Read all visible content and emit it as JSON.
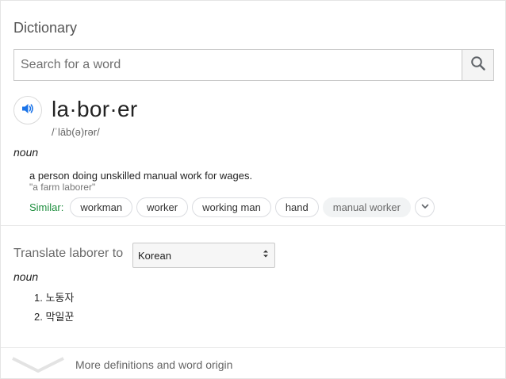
{
  "dictionary": {
    "title": "Dictionary",
    "search": {
      "placeholder": "Search for a word",
      "value": ""
    },
    "icons": {
      "search": "search-icon",
      "speaker": "speaker-icon",
      "expand": "chevron-down-icon"
    },
    "entry": {
      "headword": "la·bor·er",
      "phonetic": "/ˈlāb(ə)rər/",
      "part_of_speech": "noun",
      "definition": "a person doing unskilled manual work for wages.",
      "example": "\"a farm laborer\"",
      "similar_label": "Similar:",
      "similar": [
        "workman",
        "worker",
        "working man",
        "hand",
        "manual worker"
      ]
    },
    "translate": {
      "label": "Translate laborer to",
      "selected_language": "Korean",
      "part_of_speech": "noun",
      "translations": [
        "1. 노동자",
        "2. 막일꾼"
      ]
    },
    "more_label": "More definitions and word origin"
  },
  "colors": {
    "accent_blue": "#1a73e8",
    "similar_green": "#1e8e3e",
    "chip_border": "#dadce0",
    "muted_text": "#6a6a6a"
  }
}
